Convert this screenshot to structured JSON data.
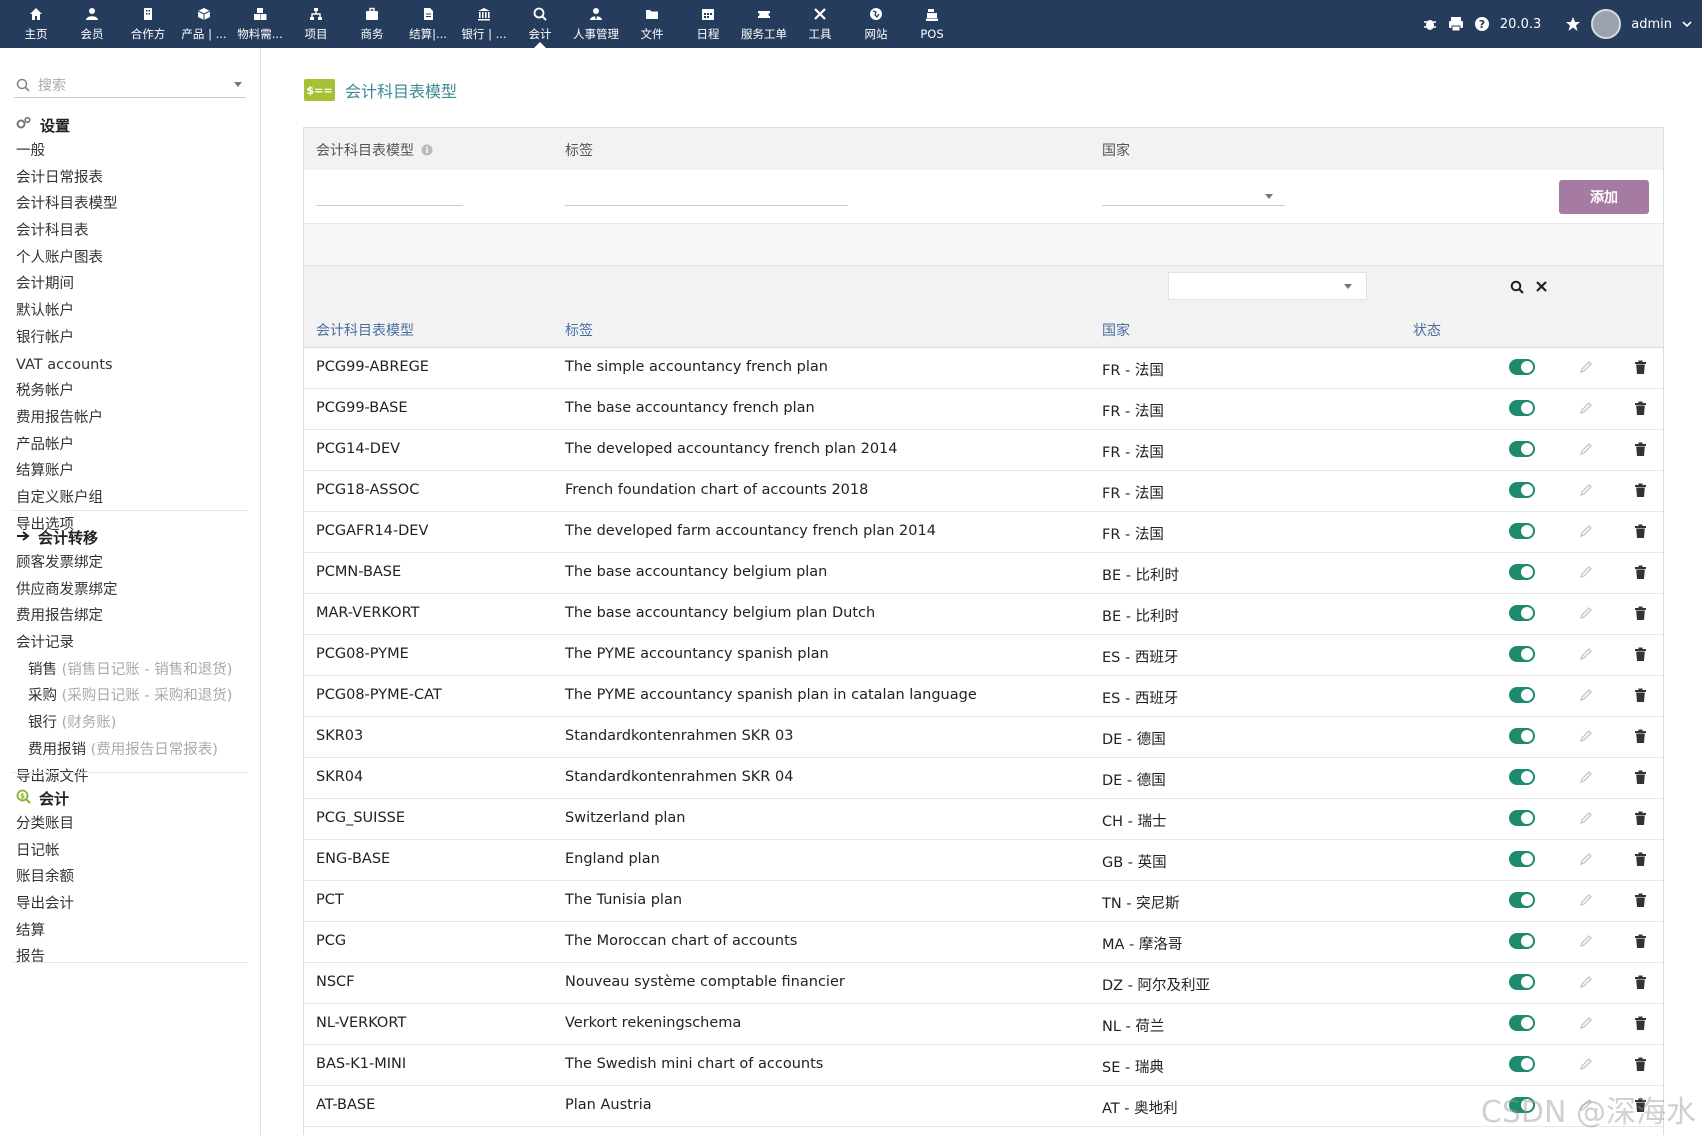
{
  "topnav": {
    "items": [
      {
        "label": "主页",
        "icon": "home-icon"
      },
      {
        "label": "会员",
        "icon": "user-icon"
      },
      {
        "label": "合作方",
        "icon": "building-icon"
      },
      {
        "label": "产品 | ...",
        "icon": "cube-icon"
      },
      {
        "label": "物料需...",
        "icon": "cubes-icon"
      },
      {
        "label": "项目",
        "icon": "sitemap-icon"
      },
      {
        "label": "商务",
        "icon": "briefcase-icon"
      },
      {
        "label": "结算|...",
        "icon": "file-invoice-icon"
      },
      {
        "label": "银行 | ...",
        "icon": "bank-icon"
      },
      {
        "label": "会计",
        "icon": "search-dollar-icon",
        "active": true
      },
      {
        "label": "人事管理",
        "icon": "user-tie-icon"
      },
      {
        "label": "文件",
        "icon": "folder-icon"
      },
      {
        "label": "日程",
        "icon": "calendar-icon"
      },
      {
        "label": "服务工单",
        "icon": "ticket-icon"
      },
      {
        "label": "工具",
        "icon": "tools-icon"
      },
      {
        "label": "网站",
        "icon": "globe-icon"
      },
      {
        "label": "POS",
        "icon": "cash-register-icon"
      }
    ],
    "version": "20.0.3",
    "user": "admin"
  },
  "sidebar": {
    "search_placeholder": "搜索",
    "sections": [
      {
        "title": "设置",
        "icon": "cogs-icon",
        "items": [
          "一般",
          "会计日常报表",
          "会计科目表模型",
          "会计科目表",
          "个人账户图表",
          "会计期间",
          "默认帐户",
          "银行帐户",
          "VAT accounts",
          "税务帐户",
          "费用报告帐户",
          "产品帐户",
          "结算账户",
          "自定义账户组",
          "导出选项"
        ]
      },
      {
        "title": "会计转移",
        "icon": "arrow-right-icon",
        "items": [
          {
            "label": "顾客发票绑定"
          },
          {
            "label": "供应商发票绑定"
          },
          {
            "label": "费用报告绑定"
          },
          {
            "label": "会计记录"
          },
          {
            "label": "销售",
            "extra": " (销售日记账 - 销售和退货)",
            "sub": true
          },
          {
            "label": "采购",
            "extra": " (采购日记账 - 采购和退货)",
            "sub": true
          },
          {
            "label": "银行",
            "extra": " (财务账)",
            "sub": true
          },
          {
            "label": "费用报销",
            "extra": " (费用报告日常报表)",
            "sub": true
          },
          {
            "label": "导出源文件"
          }
        ]
      },
      {
        "title": "会计",
        "icon": "search-dollar-icon",
        "items": [
          "分类账目",
          "日记帐",
          "账目余额",
          "导出会计",
          "结算",
          "报告"
        ]
      }
    ]
  },
  "page": {
    "title": "会计科目表模型",
    "badge": "$=="
  },
  "form": {
    "col_model": "会计科目表模型",
    "col_label": "标签",
    "col_country": "国家",
    "add_button": "添加"
  },
  "table": {
    "headers": {
      "model": "会计科目表模型",
      "label": "标签",
      "country": "国家",
      "status": "状态"
    },
    "rows": [
      {
        "model": "PCG99-ABREGE",
        "label": "The simple accountancy french plan",
        "country": "FR - 法国"
      },
      {
        "model": "PCG99-BASE",
        "label": "The base accountancy french plan",
        "country": "FR - 法国"
      },
      {
        "model": "PCG14-DEV",
        "label": "The developed accountancy french plan 2014",
        "country": "FR - 法国"
      },
      {
        "model": "PCG18-ASSOC",
        "label": "French foundation chart of accounts 2018",
        "country": "FR - 法国"
      },
      {
        "model": "PCGAFR14-DEV",
        "label": "The developed farm accountancy french plan 2014",
        "country": "FR - 法国"
      },
      {
        "model": "PCMN-BASE",
        "label": "The base accountancy belgium plan",
        "country": "BE - 比利时"
      },
      {
        "model": "MAR-VERKORT",
        "label": "The base accountancy belgium plan Dutch",
        "country": "BE - 比利时"
      },
      {
        "model": "PCG08-PYME",
        "label": "The PYME accountancy spanish plan",
        "country": "ES - 西班牙"
      },
      {
        "model": "PCG08-PYME-CAT",
        "label": "The PYME accountancy spanish plan in catalan language",
        "country": "ES - 西班牙"
      },
      {
        "model": "SKR03",
        "label": "Standardkontenrahmen SKR 03",
        "country": "DE - 德国"
      },
      {
        "model": "SKR04",
        "label": "Standardkontenrahmen SKR 04",
        "country": "DE - 德国"
      },
      {
        "model": "PCG_SUISSE",
        "label": "Switzerland plan",
        "country": "CH - 瑞士"
      },
      {
        "model": "ENG-BASE",
        "label": "England plan",
        "country": "GB - 英国"
      },
      {
        "model": "PCT",
        "label": "The Tunisia plan",
        "country": "TN - 突尼斯"
      },
      {
        "model": "PCG",
        "label": "The Moroccan chart of accounts",
        "country": "MA - 摩洛哥"
      },
      {
        "model": "NSCF",
        "label": "Nouveau système comptable financier",
        "country": "DZ - 阿尔及利亚"
      },
      {
        "model": "NL-VERKORT",
        "label": "Verkort rekeningschema",
        "country": "NL - 荷兰"
      },
      {
        "model": "BAS-K1-MINI",
        "label": "The Swedish mini chart of accounts",
        "country": "SE - 瑞典"
      },
      {
        "model": "AT-BASE",
        "label": "Plan Austria",
        "country": "AT - 奥地利"
      }
    ]
  },
  "watermark": "CSDN @深海水",
  "colors": {
    "topbar": "#263c5c",
    "accent": "#3a8b94",
    "toggle_on": "#1e8a6e",
    "add_button": "#a57aa3",
    "badge": "#a5c236"
  }
}
